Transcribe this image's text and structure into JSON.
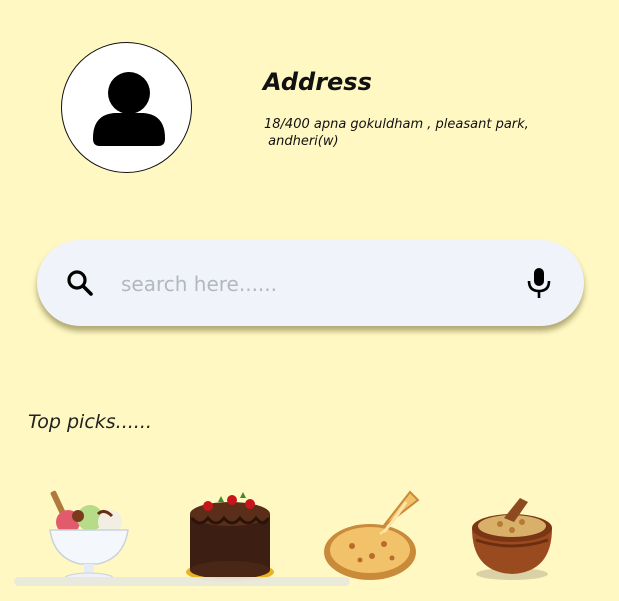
{
  "profile": {
    "avatar_icon": "person-icon"
  },
  "address": {
    "title": "Address",
    "line1": "18/400 apna gokuldham , pleasant park,",
    "line2": " andheri(w)"
  },
  "search": {
    "placeholder": "search here......",
    "value": "",
    "left_icon": "search-icon",
    "right_icon": "microphone-icon"
  },
  "top_picks": {
    "heading": "Top picks......",
    "items": [
      {
        "icon": "ice-cream-sundae-icon"
      },
      {
        "icon": "chocolate-cake-icon"
      },
      {
        "icon": "pizza-icon"
      },
      {
        "icon": "biryani-icon"
      }
    ]
  },
  "colors": {
    "background": "#FFF8C2",
    "search_bar": "#F0F3F9",
    "text": "#111111",
    "placeholder": "#B3B7BF"
  }
}
